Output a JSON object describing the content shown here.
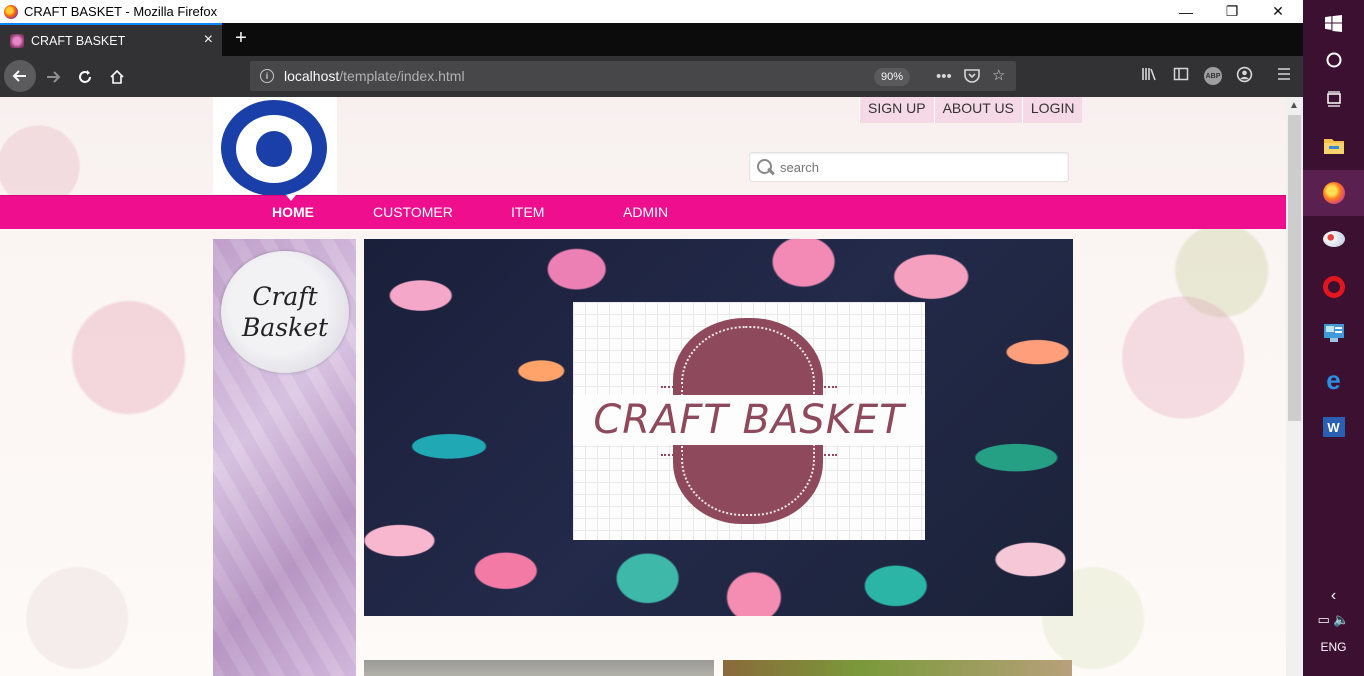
{
  "window": {
    "title": "CRAFT BASKET - Mozilla Firefox",
    "controls": {
      "minimize": "—",
      "restore": "❐",
      "close": "✕"
    }
  },
  "tab": {
    "title": "CRAFT BASKET",
    "close": "×",
    "new_tab": "+"
  },
  "navbar": {
    "url_host": "localhost",
    "url_path": "/template/index.html",
    "zoom": "90%",
    "icons": [
      "back-icon",
      "forward-icon",
      "reload-icon",
      "home-icon",
      "info-icon",
      "more-icon",
      "pocket-icon",
      "bookmark-star-icon",
      "library-icon",
      "sidebar-icon",
      "adblock-icon",
      "account-icon",
      "menu-icon"
    ],
    "adblock_label": "ABP"
  },
  "page": {
    "topnav": [
      "SIGN UP",
      "ABOUT US",
      "LOGIN"
    ],
    "search_placeholder": "search",
    "menu": [
      "HOME",
      "CUSTOMER",
      "ITEM",
      "ADMIN"
    ],
    "sidebar_logo": [
      "Craft",
      "Basket"
    ],
    "banner_title": "CRAFT BASKET"
  },
  "taskbar": {
    "items": [
      "windows-start-icon",
      "cortana-icon",
      "task-view-icon",
      "file-explorer-icon",
      "firefox-icon",
      "paint-icon",
      "opera-icon",
      "control-panel-icon",
      "edge-icon",
      "word-icon"
    ],
    "language": "ENG"
  }
}
